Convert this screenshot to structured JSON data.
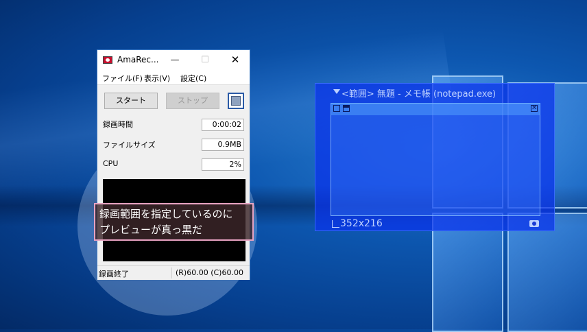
{
  "window": {
    "title": "AmaRec...",
    "min_glyph": "—",
    "max_glyph": "☐",
    "close_glyph": "✕",
    "menu": [
      "ファイル(F)",
      "表示(V)",
      "設定(C)"
    ],
    "buttons": {
      "start": "スタート",
      "stop": "ストップ"
    },
    "fields": [
      {
        "label": "録画時間",
        "value": "0:00:02"
      },
      {
        "label": "ファイルサイズ",
        "value": "0.9MB"
      },
      {
        "label": "CPU",
        "value": "2%"
      }
    ],
    "status": {
      "left": "録画終了",
      "right": "(R)60.00 (C)60.00"
    }
  },
  "callout": {
    "line1": "録画範囲を指定しているのに",
    "line2": "プレビューが真っ黒だ"
  },
  "range": {
    "title": "<範囲> 無題 - メモ帳 (notepad.exe)",
    "size": "352x216"
  },
  "colors": {
    "range_bg": "#0a32eb",
    "callout_border": "#e7a3c2",
    "titlebar_close": "#000000"
  }
}
